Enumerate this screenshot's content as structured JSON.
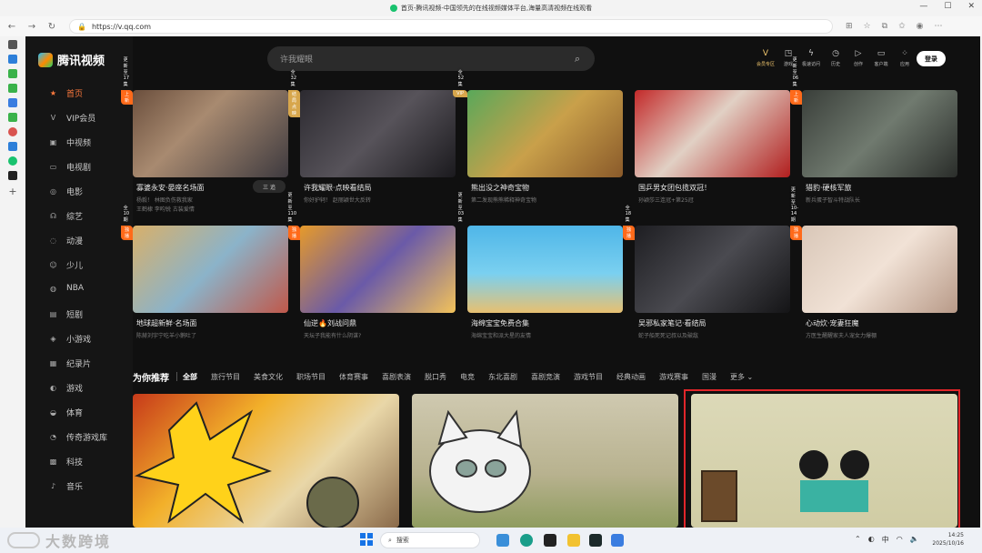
{
  "window": {
    "title": "首页-腾讯视频-中国领先的在线视频媒体平台,海量高清视频在线观看",
    "controls": [
      "—",
      "☐",
      "✕"
    ]
  },
  "browser": {
    "url": "https://v.qq.com",
    "nav": [
      "←",
      "→",
      "↻"
    ]
  },
  "site": {
    "logo_text": "腾讯视频",
    "search_placeholder": "许我耀眼",
    "login_label": "登录"
  },
  "sidebar": {
    "items": [
      {
        "label": "首页",
        "icon": "★"
      },
      {
        "label": "VIP会员",
        "icon": "V"
      },
      {
        "label": "中视频",
        "icon": "▣"
      },
      {
        "label": "电视剧",
        "icon": "▭"
      },
      {
        "label": "电影",
        "icon": "◎"
      },
      {
        "label": "综艺",
        "icon": "☊"
      },
      {
        "label": "动漫",
        "icon": "◌"
      },
      {
        "label": "少儿",
        "icon": "☺"
      },
      {
        "label": "NBA",
        "icon": "◍"
      },
      {
        "label": "短剧",
        "icon": "▤"
      },
      {
        "label": "小游戏",
        "icon": "◈"
      },
      {
        "label": "纪录片",
        "icon": "▦"
      },
      {
        "label": "游戏",
        "icon": "◐"
      },
      {
        "label": "体育",
        "icon": "◒"
      },
      {
        "label": "传奇游戏库",
        "icon": "◔"
      },
      {
        "label": "科技",
        "icon": "▩"
      },
      {
        "label": "音乐",
        "icon": "♪"
      }
    ]
  },
  "top_icons": [
    {
      "glyph": "V",
      "label": "会员专区"
    },
    {
      "glyph": "◳",
      "label": "游戏"
    },
    {
      "glyph": "ϟ",
      "label": "极速访问"
    },
    {
      "glyph": "◷",
      "label": "历史"
    },
    {
      "glyph": "▷",
      "label": "创作"
    },
    {
      "glyph": "▭",
      "label": "客户端"
    },
    {
      "glyph": "⁘",
      "label": "应用"
    }
  ],
  "row1": [
    {
      "title": "寡婆永安·晏座名场面",
      "sub": "杨毅！ 林图负伤救我家",
      "sub2": "王鹤棣 李昀锐 古装爱情",
      "badge": "上新",
      "badge_color": "#ff6a1a",
      "ep": "更新至17集",
      "follow": "三 追"
    },
    {
      "title": "许我耀眼·点映看结局",
      "sub": "你好护轲！ 赵丽颖世大反转",
      "sub2": "",
      "badge": "结局点映",
      "badge_color": "#d7a64c",
      "ep": "全32集"
    },
    {
      "title": "熊出没之神奇宝物",
      "sub": "第二发现熊熊稀释神奇宝物",
      "sub2": "",
      "badge": "VIP",
      "badge_color": "#d7a64c",
      "ep": "全52集"
    },
    {
      "title": "国乒男女团包揽双冠！",
      "sub": "孙颖莎三连冠+第25冠",
      "sub2": "",
      "badge": "",
      "badge_color": "",
      "ep": ""
    },
    {
      "title": "猎豹·硬核军旅",
      "sub": "新兵蛋子智斗特战队长",
      "sub2": "",
      "badge": "上新",
      "badge_color": "#ff6a1a",
      "ep": "更新至06集"
    }
  ],
  "row2": [
    {
      "title": "地球超新鲜·名场面",
      "sub": "陈赫刘宇宁吃羊小鹅吐了",
      "badge": "独播",
      "badge_color": "#ff6a1a",
      "ep": "全10期"
    },
    {
      "title": "仙逆🔥刘战问鼎",
      "sub": "天坛子我能有什么阴谋?",
      "badge": "独播",
      "badge_color": "#ff6a1a",
      "ep": "更新至110集"
    },
    {
      "title": "海绵宝宝免费合集",
      "sub": "海绵宝宝和派大星的友情",
      "badge": "",
      "badge_color": "",
      "ep": "更新至03集"
    },
    {
      "title": "吴邪私家笔记·看结局",
      "sub": "蛇子船死死记叔以及破敌",
      "badge": "独播",
      "badge_color": "#ff6a1a",
      "ep": "全18集"
    },
    {
      "title": "心动炊·宠妻狂魔",
      "sub": "方医生醒醒家夫人宠女力爆棚",
      "badge": "独播",
      "badge_color": "#ff6a1a",
      "ep": "更新至10-14期"
    }
  ],
  "recommend": {
    "title": "为你推荐",
    "tabs": [
      "全部",
      "旅行节目",
      "美食文化",
      "职场节目",
      "体育赛事",
      "喜剧表演",
      "脱口秀",
      "电竞",
      "东北喜剧",
      "喜剧竞演",
      "游戏节目",
      "经典动画",
      "游戏赛事",
      "国漫",
      "更多 ⌄"
    ]
  },
  "taskbar": {
    "watermark": "大数跨境",
    "search_placeholder": "搜索",
    "tray": [
      "⌃",
      "◐",
      "中",
      "◠",
      "🔈"
    ],
    "time": "14:25",
    "date": "2025/10/16"
  }
}
